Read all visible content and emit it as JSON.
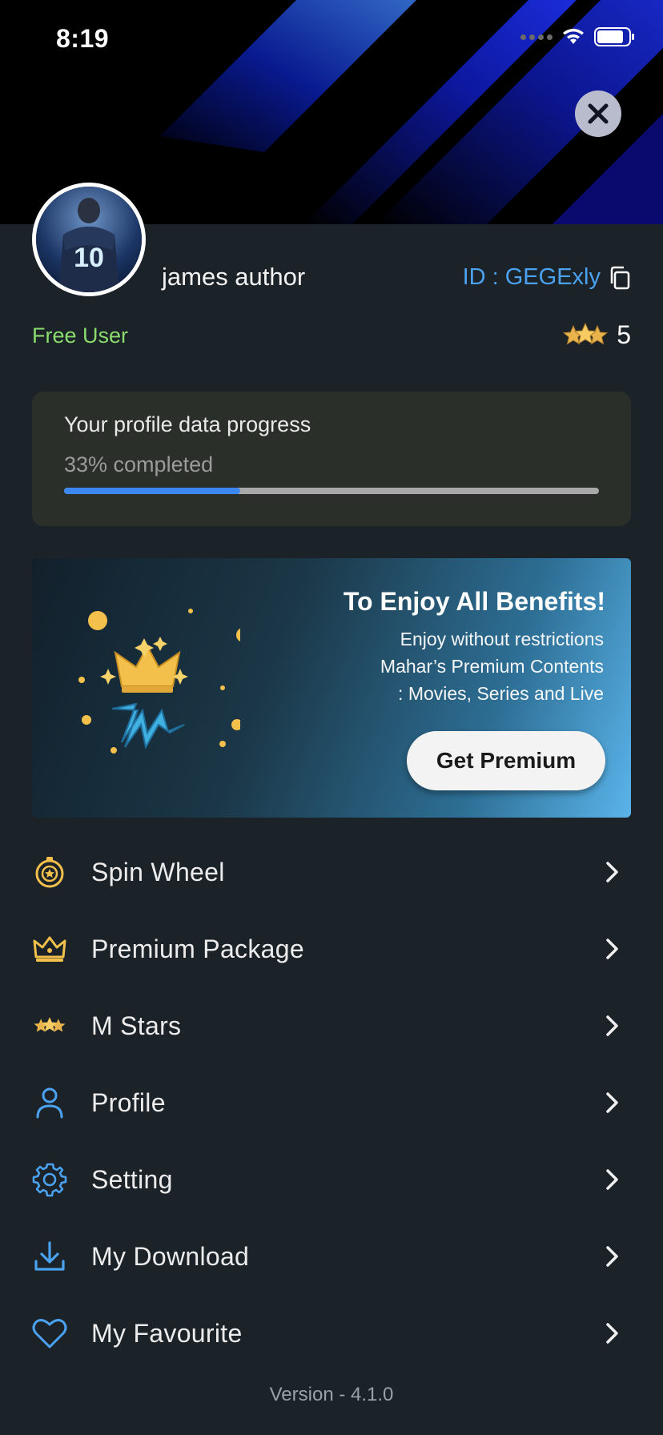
{
  "status_bar": {
    "time": "8:19"
  },
  "profile": {
    "name": "james author",
    "id_text": "ID : GEGExly",
    "tier": "Free User",
    "stars": "5"
  },
  "progress": {
    "title": "Your profile data progress",
    "status": "33% completed",
    "percent": 33
  },
  "premium_banner": {
    "heading": "To Enjoy All Benefits!",
    "line1": "Enjoy without restrictions",
    "line2": "Mahar’s Premium Contents",
    "line3": ": Movies, Series and Live",
    "button": "Get Premium"
  },
  "menu": [
    {
      "label": "Spin Wheel",
      "icon": "spin-wheel-icon"
    },
    {
      "label": "Premium Package",
      "icon": "crown-icon"
    },
    {
      "label": "M Stars",
      "icon": "stars-icon"
    },
    {
      "label": "Profile",
      "icon": "user-icon"
    },
    {
      "label": "Setting",
      "icon": "gear-icon"
    },
    {
      "label": "My Download",
      "icon": "download-icon"
    },
    {
      "label": "My Favourite",
      "icon": "heart-icon"
    }
  ],
  "version": "Version - 4.1.0",
  "colors": {
    "background": "#1b2228",
    "accent_blue": "#4aa2f0",
    "free_user_green": "#8bdc6e",
    "progress_fill": "#3d88f0",
    "gold": "#f2c04b"
  }
}
